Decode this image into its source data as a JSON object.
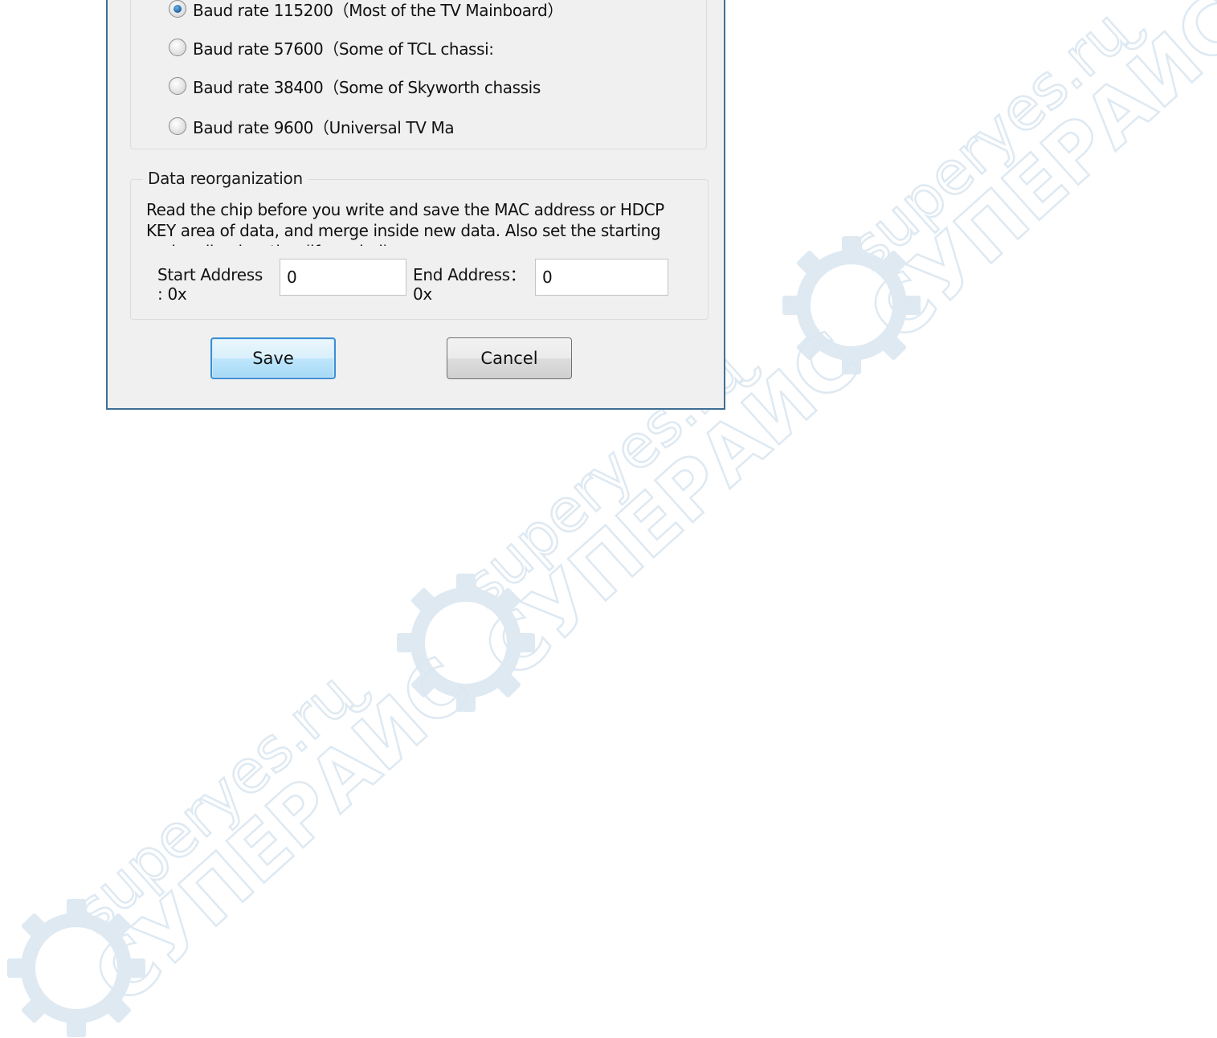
{
  "dialog": {
    "baud_group": {
      "options": [
        {
          "label": "Baud rate 115200（Most of the TV Mainboard）",
          "checked": true
        },
        {
          "label": "Baud rate 57600（Some of TCL chassi:",
          "checked": false
        },
        {
          "label": "Baud rate 38400（Some of Skyworth chassis",
          "checked": false
        },
        {
          "label": "Baud rate 9600（Universal TV Ma",
          "checked": false
        }
      ]
    },
    "reorg_group": {
      "legend": "Data reorganization",
      "description": "Read the chip before you write and save the MAC address or HDCP KEY area of data, and merge inside new data. Also set the starting and ending location (if needed)",
      "start_label": "Start Address\n: 0x",
      "start_value": "0",
      "end_label": "End Address：\n0x",
      "end_value": "0"
    },
    "buttons": {
      "save_label": "Save",
      "cancel_label": "Cancel"
    }
  },
  "watermark": {
    "lines": [
      "superyes.ru",
      "СУПЕРАЙС"
    ],
    "color": "#dbe7f1",
    "icon": "gear-icon"
  },
  "colors": {
    "dialog_border": "#3f6e94",
    "dialog_bg": "#f0f0f0",
    "accent": "#3c8fd4"
  }
}
